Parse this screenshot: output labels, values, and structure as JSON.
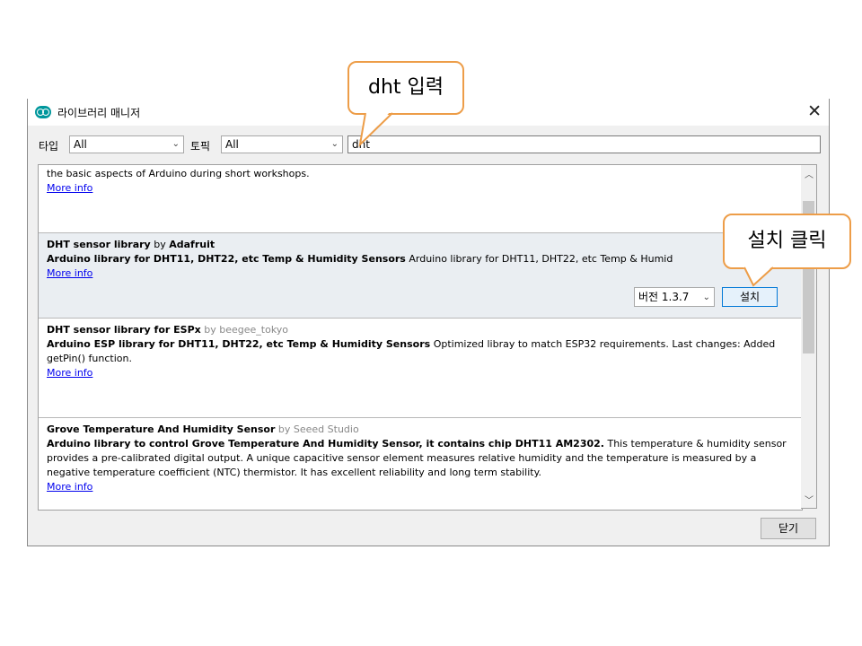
{
  "window": {
    "title": "라이브러리 매니저",
    "close_glyph": "✕"
  },
  "filters": {
    "type_label": "타입",
    "type_value": "All",
    "topic_label": "토픽",
    "topic_value": "All",
    "search_value": "dht"
  },
  "items": [
    {
      "desc": "the basic aspects of Arduino during short workshops.",
      "more": "More info"
    },
    {
      "name": "DHT sensor library",
      "by_word": "by",
      "author": "Adafruit",
      "bold_desc": "Arduino library for DHT11, DHT22, etc Temp & Humidity Sensors",
      "desc": "Arduino library for DHT11, DHT22, etc Temp & Humid",
      "more": "More info",
      "version": "버전 1.3.7",
      "install": "설치"
    },
    {
      "name": "DHT sensor library for ESPx",
      "by_author": "by beegee_tokyo",
      "bold_desc": "Arduino ESP library for DHT11, DHT22, etc Temp & Humidity Sensors",
      "desc": "Optimized libray to match ESP32 requirements. Last changes: Added getPin() function.",
      "more": "More info"
    },
    {
      "name": "Grove Temperature And Humidity Sensor",
      "by_author": "by Seeed Studio",
      "bold_desc": "Arduino library to control Grove Temperature And Humidity Sensor, it contains chip DHT11 AM2302.",
      "desc": "This temperature & humidity sensor provides a pre-calibrated digital output. A unique capacitive sensor element measures relative humidity and the temperature is measured by a negative temperature coefficient (NTC) thermistor. It has excellent reliability and long term stability.",
      "more": "More info"
    }
  ],
  "footer": {
    "close_label": "닫기"
  },
  "callouts": {
    "search": "dht 입력",
    "install": "설치 클릭"
  },
  "colors": {
    "callout_border": "#ed9d48",
    "link": "#0000ee",
    "install_border": "#0078d7"
  }
}
